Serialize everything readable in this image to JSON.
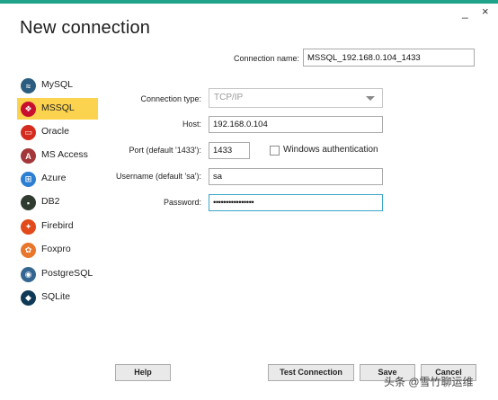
{
  "window": {
    "minimize_glyph": "_",
    "close_glyph": "×",
    "title": "New connection",
    "accent_color": "#1fa38a"
  },
  "connection_name": {
    "label": "Connection name:",
    "value": "MSSQL_192.168.0.104_1433"
  },
  "sidebar": {
    "active_color": "#fbd34f",
    "items": [
      {
        "label": "MySQL",
        "icon": "mysql-icon",
        "color": "#2b5d80",
        "glyph": "≈"
      },
      {
        "label": "MSSQL",
        "icon": "mssql-icon",
        "color": "#c8102e",
        "glyph": "❖"
      },
      {
        "label": "Oracle",
        "icon": "oracle-icon",
        "color": "#d52b1e",
        "glyph": "▭"
      },
      {
        "label": "MS Access",
        "icon": "ms-access-icon",
        "color": "#a4373a",
        "glyph": "A"
      },
      {
        "label": "Azure",
        "icon": "azure-icon",
        "color": "#2d7fd3",
        "glyph": "⊞"
      },
      {
        "label": "DB2",
        "icon": "db2-icon",
        "color": "#2f3b2f",
        "glyph": "▪"
      },
      {
        "label": "Firebird",
        "icon": "firebird-icon",
        "color": "#e24a1b",
        "glyph": "✦"
      },
      {
        "label": "Foxpro",
        "icon": "foxpro-icon",
        "color": "#e8762c",
        "glyph": "✿"
      },
      {
        "label": "PostgreSQL",
        "icon": "postgresql-icon",
        "color": "#336791",
        "glyph": "◉"
      },
      {
        "label": "SQLite",
        "icon": "sqlite-icon",
        "color": "#0f3a57",
        "glyph": "◆"
      }
    ]
  },
  "form": {
    "connection_type": {
      "label": "Connection type:",
      "value": "TCP/IP"
    },
    "host": {
      "label": "Host:",
      "value": "192.168.0.104"
    },
    "port": {
      "label": "Port (default '1433'):",
      "value": "1433"
    },
    "windows_auth": {
      "label": "Windows authentication",
      "checked": false
    },
    "username": {
      "label": "Username (default 'sa'):",
      "value": "sa"
    },
    "password": {
      "label": "Password:",
      "value": "••••••••••••••••"
    }
  },
  "buttons": {
    "help": "Help",
    "test": "Test Connection",
    "save": "Save",
    "cancel": "Cancel"
  },
  "watermark": "头条 @雪竹聊运维"
}
